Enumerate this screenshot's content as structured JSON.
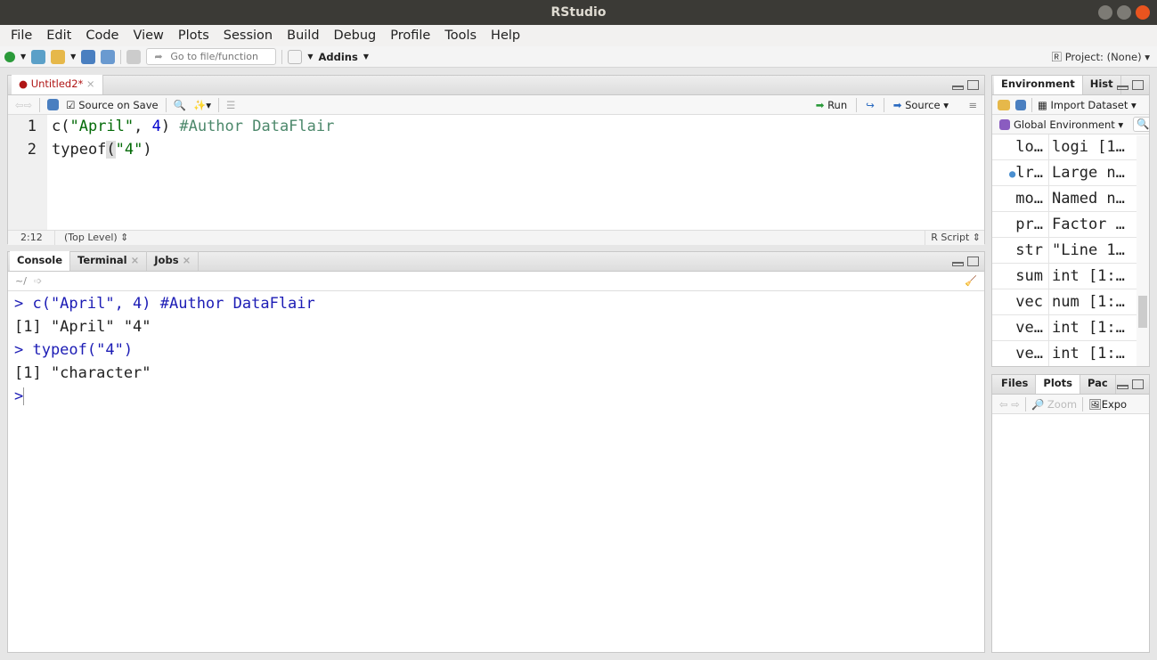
{
  "window": {
    "title": "RStudio"
  },
  "menu": [
    "File",
    "Edit",
    "Code",
    "View",
    "Plots",
    "Session",
    "Build",
    "Debug",
    "Profile",
    "Tools",
    "Help"
  ],
  "toolbar": {
    "goto_placeholder": "Go to file/function",
    "addins": "Addins",
    "project": "Project: (None)"
  },
  "source": {
    "tab": "Untitled2*",
    "source_on_save": "Source on Save",
    "run": "Run",
    "source_btn": "Source",
    "lines": [
      {
        "n": "1"
      },
      {
        "n": "2"
      }
    ],
    "status": {
      "pos": "2:12",
      "scope": "(Top Level)",
      "type": "R Script"
    }
  },
  "console": {
    "tabs": [
      "Console",
      "Terminal",
      "Jobs"
    ],
    "path": "~/",
    "lines": [
      "> c(\"April\", 4)    #Author DataFlair",
      "[1] \"April\" \"4\"",
      "> typeof(\"4\")",
      "[1] \"character\"",
      ">"
    ]
  },
  "environment": {
    "tabs": [
      "Environment",
      "Hist"
    ],
    "import": "Import Dataset",
    "scope": "Global Environment",
    "rows": [
      {
        "name": "lo…",
        "value": "logi [1…"
      },
      {
        "name": "lr…",
        "value": "Large n…"
      },
      {
        "name": "mo…",
        "value": "Named n…"
      },
      {
        "name": "pr…",
        "value": "Factor …"
      },
      {
        "name": "str",
        "value": "\"Line 1…"
      },
      {
        "name": "sum",
        "value": "int [1:…"
      },
      {
        "name": "vec",
        "value": "num [1:…"
      },
      {
        "name": "ve…",
        "value": "int [1:…"
      },
      {
        "name": "ve…",
        "value": "int [1:…"
      }
    ]
  },
  "files": {
    "tabs": [
      "Files",
      "Plots",
      "Pac"
    ],
    "zoom": "Zoom",
    "export": "Expo"
  }
}
